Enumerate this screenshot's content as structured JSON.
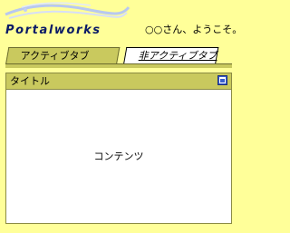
{
  "header": {
    "logo_text": "Portalworks",
    "welcome_text": "○○さん、ようこそ。"
  },
  "tabs": [
    {
      "label": "アクティブタブ",
      "active": true
    },
    {
      "label": "非アクティブタブ",
      "active": false
    }
  ],
  "portlet": {
    "title": "タイトル",
    "content": "コンテンツ",
    "maximize_icon": "maximize-icon"
  },
  "colors": {
    "page_background": "#ffff99",
    "tab_active": "#c9c95e",
    "portlet_header": "#c9c95e",
    "logo_text": "#0a1a66",
    "maximize_button": "#3a5fcd"
  }
}
